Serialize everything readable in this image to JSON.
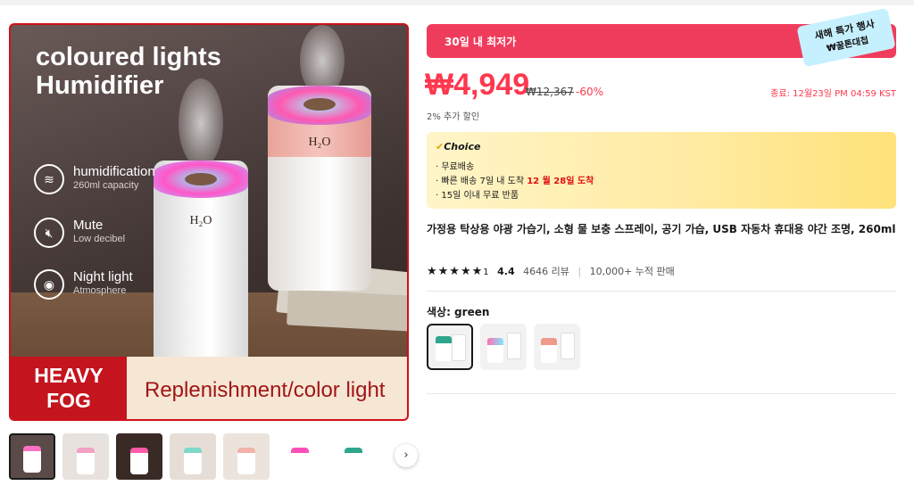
{
  "gallery": {
    "headline": "coloured lights\nHumidifier",
    "features": [
      {
        "title": "humidification",
        "sub": "260ml capacity",
        "icon": "humidifier-icon"
      },
      {
        "title": "Mute",
        "sub": "Low decibel",
        "icon": "speaker-mute-icon"
      },
      {
        "title": "Night light",
        "sub": "Atmosphere",
        "icon": "night-light-icon"
      }
    ],
    "product_label": "H₂O",
    "banner_fog": "HEAVY\nFOG",
    "banner_text": "Replenishment/color light",
    "thumbnails_count": 8
  },
  "deal": {
    "label": "30일 내 최저가",
    "tag_line1": "새해 특가 행사",
    "tag_line2": "₩꿀톤대첩"
  },
  "price": {
    "current": "₩4,949",
    "original": "₩12,367",
    "discount": "-60%",
    "ends": "종료: 12월23일 PM 04:59 KST",
    "extra": "2% 추가 할인"
  },
  "choice": {
    "brand": "Choice",
    "lines": [
      {
        "text": "· 무료배송"
      },
      {
        "text": "· 빠른 배송 7일 내 도착 ",
        "highlight": "12 월 28일 도착"
      },
      {
        "text": "· 15일 이내  무료 반품"
      }
    ]
  },
  "product": {
    "title": "가정용 탁상용 야광 가습기, 소형 물 보충 스프레이, 공기 가습, USB 자동차 휴대용 야간 조명, 260ml",
    "stars": "★★★★★",
    "star_extra": "1",
    "score": "4.4",
    "reviews": "4646 리뷰",
    "sold": "10,000+ 누적 판매"
  },
  "variants": {
    "label": "색상: green",
    "options": [
      {
        "name": "green",
        "accent": "#2ea58c",
        "selected": true
      },
      {
        "name": "multi",
        "accent": "#ff6fb0",
        "selected": false
      },
      {
        "name": "pink",
        "accent": "#ef9a8c",
        "selected": false
      }
    ]
  },
  "thumb_nav": "›"
}
